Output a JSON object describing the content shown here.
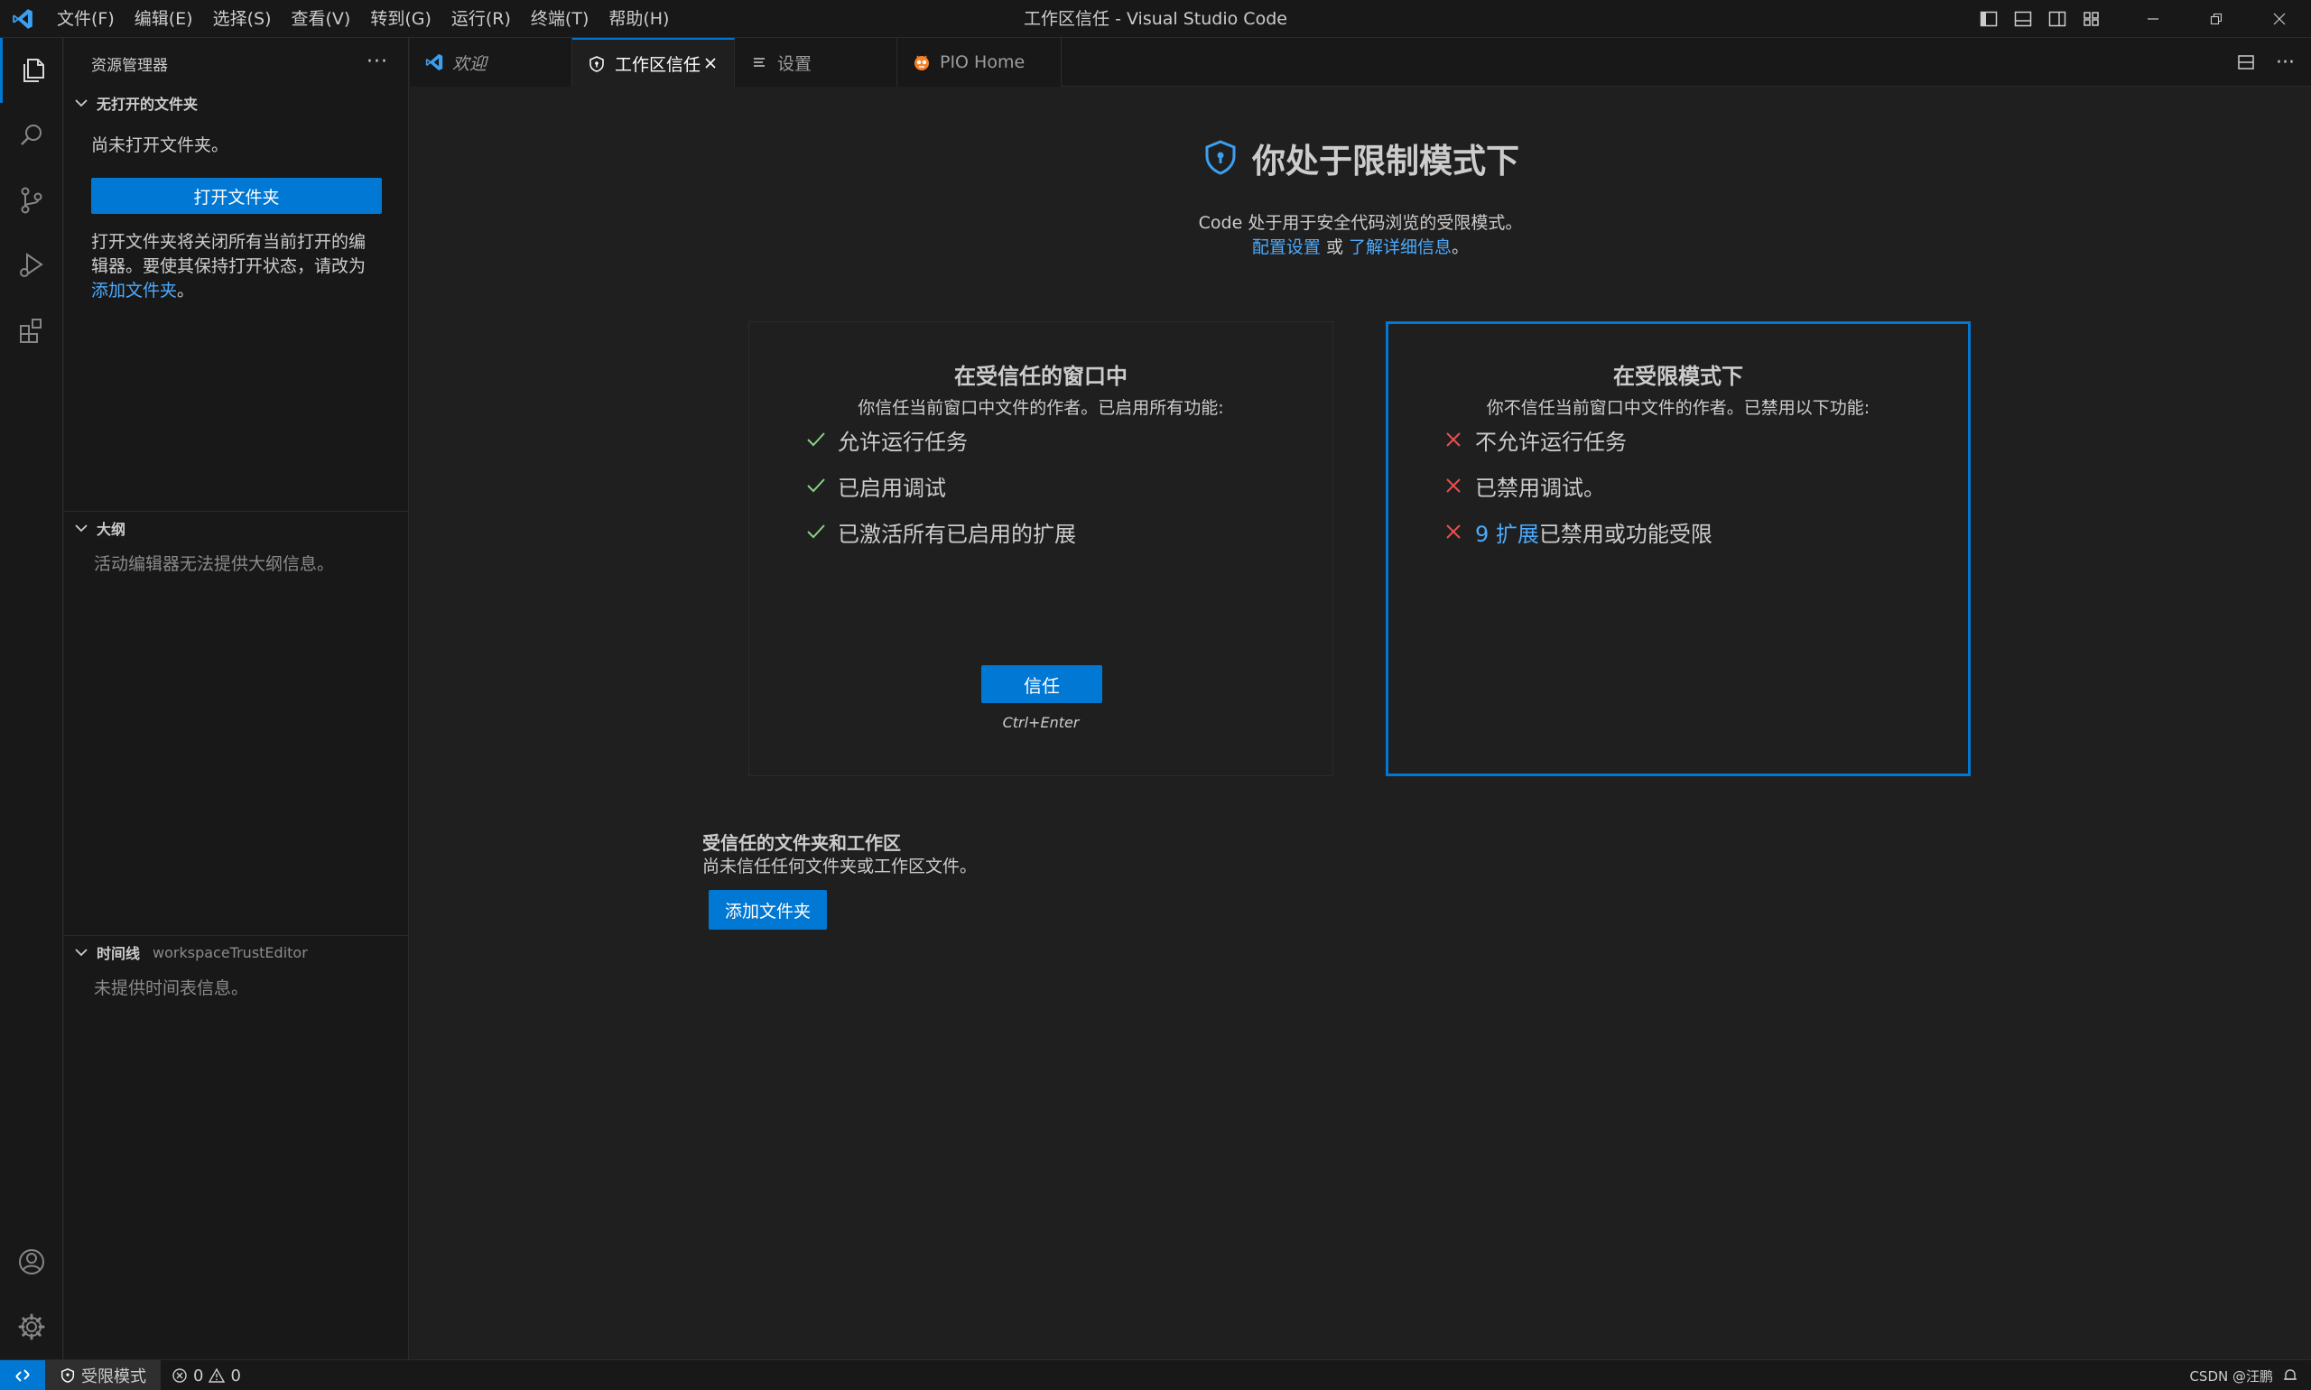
{
  "window": {
    "title": "工作区信任 - Visual Studio Code",
    "menu": [
      "文件(F)",
      "编辑(E)",
      "选择(S)",
      "查看(V)",
      "转到(G)",
      "运行(R)",
      "终端(T)",
      "帮助(H)"
    ]
  },
  "activity_bar": {
    "items": [
      "explorer",
      "search",
      "source-control",
      "run-and-debug",
      "extensions"
    ],
    "bottom": [
      "accounts",
      "manage"
    ]
  },
  "sidebar": {
    "title": "资源管理器",
    "no_folder": {
      "heading": "无打开的文件夹",
      "message": "尚未打开文件夹。",
      "button": "打开文件夹",
      "note_line1": "打开文件夹将关闭所有当前打开的编",
      "note_line2": "辑器。要使其保持打开状态，请改为",
      "note_link": "添加文件夹",
      "note_end": "。"
    },
    "outline": {
      "heading": "大纲",
      "message": "活动编辑器无法提供大纲信息。"
    },
    "timeline": {
      "heading": "时间线",
      "subtitle": "workspaceTrustEditor",
      "message": "未提供时间表信息。"
    }
  },
  "tabs": [
    {
      "label": "欢迎",
      "icon": "vscode-logo-icon",
      "italic": true,
      "active": false
    },
    {
      "label": "工作区信任",
      "icon": "shield-icon",
      "italic": false,
      "active": true
    },
    {
      "label": "设置",
      "icon": "settings-list-icon",
      "italic": false,
      "active": false
    },
    {
      "label": "PIO Home",
      "icon": "platformio-icon",
      "italic": false,
      "active": false
    }
  ],
  "trust_editor": {
    "title": "你处于限制模式下",
    "subtitle": "Code 处于用于安全代码浏览的受限模式。",
    "configure_link": "配置设置",
    "or": " 或 ",
    "learn_link": "了解详细信息",
    "period": "。",
    "trusted_card": {
      "title": "在受信任的窗口中",
      "subtitle": "你信任当前窗口中文件的作者。已启用所有功能:",
      "features": [
        "允许运行任务",
        "已启用调试",
        "已激活所有已启用的扩展"
      ],
      "button": "信任",
      "shortcut": "Ctrl+Enter"
    },
    "restricted_card": {
      "title": "在受限模式下",
      "subtitle": "你不信任当前窗口中文件的作者。已禁用以下功能:",
      "features": [
        "不允许运行任务",
        "已禁用调试。"
      ],
      "ext_link": "9 扩展",
      "ext_rest": "已禁用或功能受限"
    },
    "trusted_folders": {
      "heading": "受信任的文件夹和工作区",
      "message": "尚未信任任何文件夹或工作区文件。",
      "button": "添加文件夹"
    }
  },
  "status_bar": {
    "restricted_mode": "受限模式",
    "errors": "0",
    "warnings": "0",
    "watermark": "CSDN @汪鹏"
  },
  "colors": {
    "accent": "#0078d4",
    "link": "#4daafc",
    "check": "#89d185",
    "cross": "#f14c4c"
  }
}
